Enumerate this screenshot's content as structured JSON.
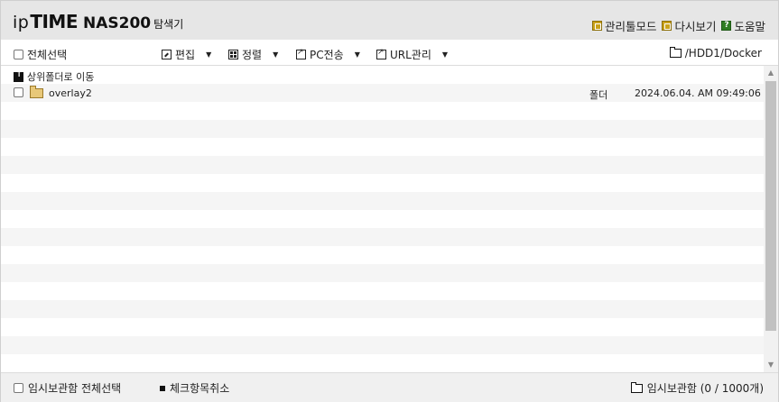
{
  "header": {
    "logo_ip": "ip",
    "logo_time": "TIME",
    "logo_model": "NAS200",
    "logo_sub": "탐색기",
    "links": {
      "admin": "관리툴모드",
      "reload": "다시보기",
      "help": "도움말"
    }
  },
  "toolbar": {
    "select_all": "전체선택",
    "edit": "편집",
    "sort": "정렬",
    "pc_transfer": "PC전송",
    "url_manage": "URL관리",
    "path": "/HDD1/Docker"
  },
  "list": {
    "up_label": "상위폴더로 이동",
    "files": [
      {
        "name": "overlay2",
        "type": "폴더",
        "date": "2024.06.04. AM 09:49:06"
      }
    ]
  },
  "footer": {
    "temp_select_all": "임시보관함 전체선택",
    "uncheck": "체크항목취소",
    "temp_box": "임시보관함 (0 / 1000개)"
  },
  "colors": {
    "header_bg": "#e6e6e6",
    "folder_yellow": "#e8c879",
    "admin_icon": "#c9a21a",
    "help_icon": "#2f7d22"
  }
}
